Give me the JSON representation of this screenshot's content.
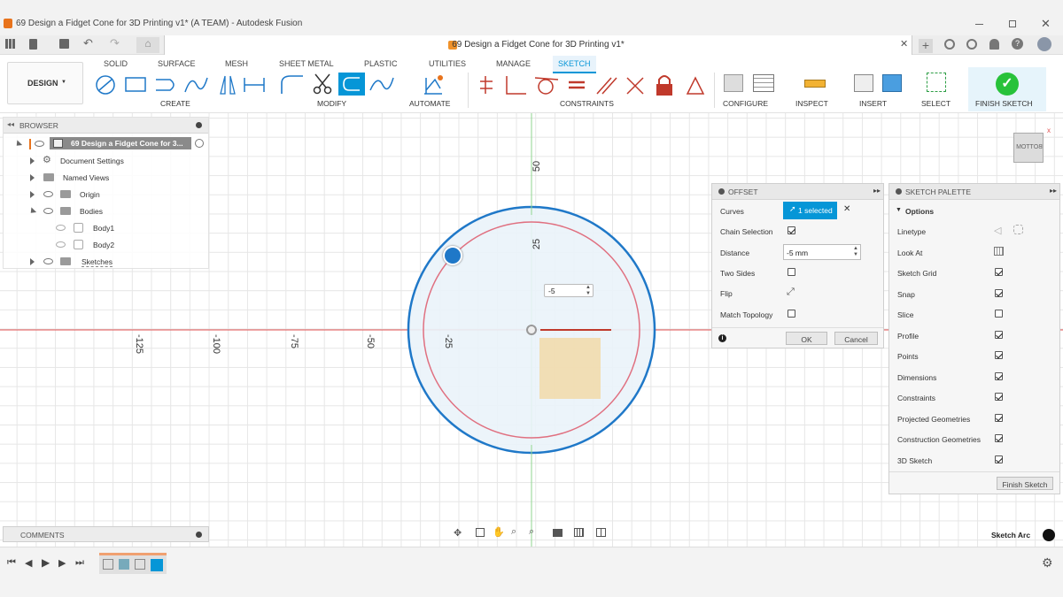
{
  "window": {
    "title": "69 Design a Fidget Cone for 3D Printing v1* (A TEAM) - Autodesk Fusion"
  },
  "doc_tab": {
    "name": "69 Design a Fidget Cone for 3D Printing v1*"
  },
  "workspace": {
    "label": "DESIGN"
  },
  "ribbon_tabs": [
    "SOLID",
    "SURFACE",
    "MESH",
    "SHEET METAL",
    "PLASTIC",
    "UTILITIES",
    "MANAGE",
    "SKETCH"
  ],
  "ribbon_groups": {
    "create": "CREATE",
    "modify": "MODIFY",
    "automate": "AUTOMATE",
    "constraints": "CONSTRAINTS",
    "configure": "CONFIGURE",
    "inspect": "INSPECT",
    "insert": "INSERT",
    "select": "SELECT",
    "finish": "FINISH SKETCH"
  },
  "browser": {
    "title": "BROWSER",
    "root": "69 Design a Fidget Cone for 3...",
    "items": [
      "Document Settings",
      "Named Views",
      "Origin",
      "Bodies",
      "Body1",
      "Body2",
      "Sketches"
    ]
  },
  "comments": {
    "label": "COMMENTS"
  },
  "axis_labels": {
    "v50": "50",
    "v25": "25",
    "h125": "-125",
    "h100": "-100",
    "h75": "-75",
    "h50": "-50",
    "h25": "-25"
  },
  "dimension_input": {
    "value": "-5"
  },
  "offset_dialog": {
    "title": "OFFSET",
    "curves_label": "Curves",
    "curves_value": "1 selected",
    "chain_selection": "Chain Selection",
    "distance_label": "Distance",
    "distance_value": "-5 mm",
    "two_sides": "Two Sides",
    "flip": "Flip",
    "match_topology": "Match Topology",
    "ok": "OK",
    "cancel": "Cancel"
  },
  "sketch_palette": {
    "title": "SKETCH PALETTE",
    "section": "Options",
    "options": [
      {
        "label": "Linetype"
      },
      {
        "label": "Look At"
      },
      {
        "label": "Sketch Grid",
        "checked": true
      },
      {
        "label": "Snap",
        "checked": true
      },
      {
        "label": "Slice",
        "checked": false
      },
      {
        "label": "Profile",
        "checked": true
      },
      {
        "label": "Points",
        "checked": true
      },
      {
        "label": "Dimensions",
        "checked": true
      },
      {
        "label": "Constraints",
        "checked": true
      },
      {
        "label": "Projected Geometries",
        "checked": true
      },
      {
        "label": "Construction Geometries",
        "checked": true
      },
      {
        "label": "3D Sketch",
        "checked": true
      }
    ],
    "finish_button": "Finish Sketch"
  },
  "viewcube": {
    "label": "BOTTOM"
  },
  "status": {
    "label": "Sketch Arc"
  },
  "colors": {
    "accent": "#0696d7",
    "circle_outer": "#1f78c8",
    "circle_inner": "#e07080",
    "axis_red": "#e05050",
    "axis_green": "#8fd68f",
    "profile_fill": "#f2d9a8"
  }
}
